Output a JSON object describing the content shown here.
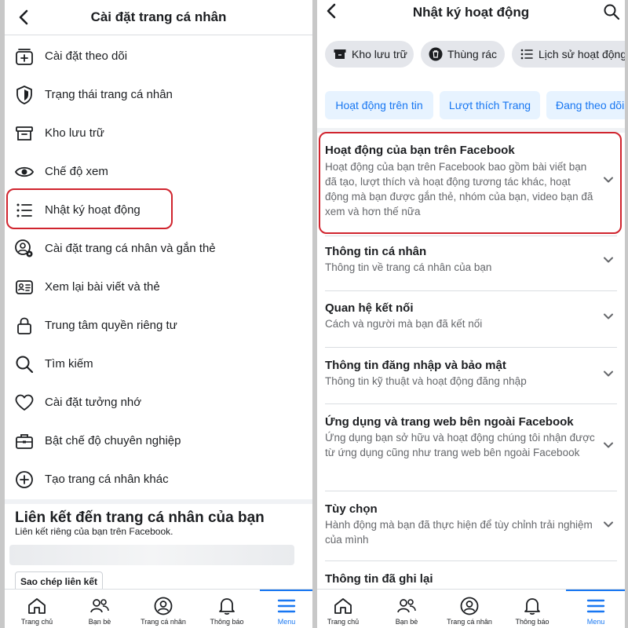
{
  "left": {
    "title": "Cài đặt trang cá nhân",
    "items": [
      {
        "label": "Cài đặt theo dõi",
        "icon": "follow-settings-icon"
      },
      {
        "label": "Trạng thái trang cá nhân",
        "icon": "shield-icon"
      },
      {
        "label": "Kho lưu trữ",
        "icon": "archive-icon"
      },
      {
        "label": "Chế độ xem",
        "icon": "eye-icon"
      },
      {
        "label": "Nhật ký hoạt động",
        "icon": "list-icon"
      },
      {
        "label": "Cài đặt trang cá nhân và gắn thẻ",
        "icon": "profile-gear-icon"
      },
      {
        "label": "Xem lại bài viết và thẻ",
        "icon": "tag-review-icon"
      },
      {
        "label": "Trung tâm quyền riêng tư",
        "icon": "lock-icon"
      },
      {
        "label": "Tìm kiếm",
        "icon": "search-icon"
      },
      {
        "label": "Cài đặt tưởng nhớ",
        "icon": "heart-icon"
      },
      {
        "label": "Bật chế độ chuyên nghiệp",
        "icon": "briefcase-icon"
      },
      {
        "label": "Tạo trang cá nhân khác",
        "icon": "plus-circle-icon"
      }
    ],
    "link_section": {
      "title": "Liên kết đến trang cá nhân của bạn",
      "desc": "Liên kết riêng của bạn trên Facebook.",
      "copy_label": "Sao chép liên kết"
    }
  },
  "right": {
    "title": "Nhật ký hoạt động",
    "chips": [
      {
        "label": "Kho lưu trữ",
        "icon": "archive-icon"
      },
      {
        "label": "Thùng rác",
        "icon": "trash-icon"
      },
      {
        "label": "Lịch sử hoạt động",
        "icon": "list-icon"
      }
    ],
    "tabs": [
      "Hoạt động trên tin",
      "Lượt thích Trang",
      "Đang theo dõi"
    ],
    "sections": [
      {
        "title": "Hoạt động của bạn trên Facebook",
        "desc": "Hoạt động của bạn trên Facebook bao gồm bài viết bạn đã tạo, lượt thích và hoạt động tương tác khác, hoạt động mà bạn được gắn thẻ, nhóm của bạn, video bạn đã xem và hơn thế nữa"
      },
      {
        "title": "Thông tin cá nhân",
        "desc": "Thông tin về trang cá nhân của bạn"
      },
      {
        "title": "Quan hệ kết nối",
        "desc": "Cách và người mà bạn đã kết nối"
      },
      {
        "title": "Thông tin đăng nhập và bảo mật",
        "desc": "Thông tin kỹ thuật và hoạt động đăng nhập"
      },
      {
        "title": "Ứng dụng và trang web bên ngoài Facebook",
        "desc": "Ứng dụng bạn sở hữu và hoạt động chúng tôi nhận được từ ứng dụng cũng như trang web bên ngoài Facebook"
      },
      {
        "title": "Tùy chọn",
        "desc": "Hành động mà bạn đã thực hiện để tùy chỉnh trải nghiệm của mình"
      },
      {
        "title": "Thông tin đã ghi lại",
        "desc": ""
      }
    ]
  },
  "nav_left": [
    {
      "label": "Trang chủ",
      "icon": "home-icon"
    },
    {
      "label": "Bạn bè",
      "icon": "friends-icon"
    },
    {
      "label": "Trang cá nhân",
      "icon": "profile-icon"
    },
    {
      "label": "Thông báo",
      "icon": "bell-icon"
    },
    {
      "label": "Menu",
      "icon": "menu-icon"
    }
  ],
  "nav_right": [
    {
      "label": "Trang chủ",
      "icon": "home-icon"
    },
    {
      "label": "Bạn bè",
      "icon": "friends-icon"
    },
    {
      "label": "Trang cá nhân",
      "icon": "profile-icon"
    },
    {
      "label": "Thông báo",
      "icon": "bell-icon"
    },
    {
      "label": "Menu",
      "icon": "menu-icon"
    }
  ],
  "colors": {
    "accent": "#1877f2",
    "highlight": "#d0242e",
    "text": "#1c1e21",
    "muted": "#65676b"
  }
}
